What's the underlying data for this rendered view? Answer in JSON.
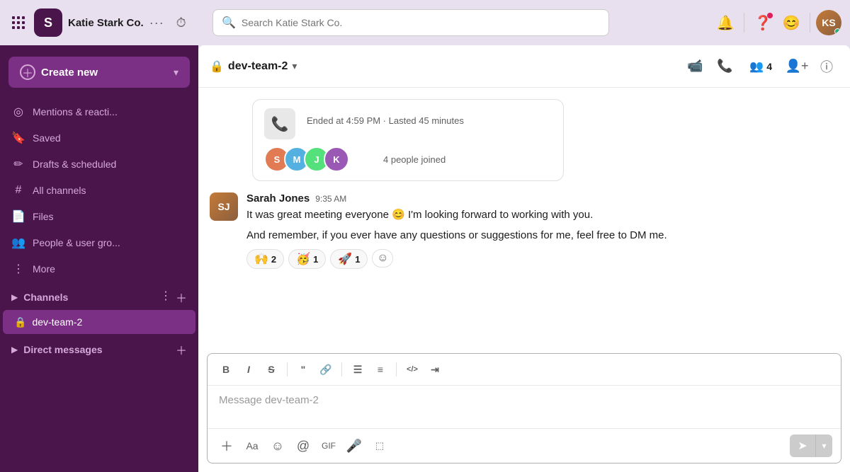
{
  "topbar": {
    "workspace_name": "Katie Stark Co.",
    "workspace_dots": "···",
    "search_placeholder": "Search Katie Stark Co.",
    "app_logo_letter": "S"
  },
  "sidebar": {
    "create_new_label": "Create new",
    "nav_items": [
      {
        "id": "mentions",
        "icon": "@",
        "label": "Mentions & reacti..."
      },
      {
        "id": "saved",
        "icon": "🔖",
        "label": "Saved"
      },
      {
        "id": "drafts",
        "icon": "✏️",
        "label": "Drafts & scheduled"
      },
      {
        "id": "all-channels",
        "icon": "#",
        "label": "All channels"
      },
      {
        "id": "files",
        "icon": "📄",
        "label": "Files"
      },
      {
        "id": "people",
        "icon": "👥",
        "label": "People & user gro..."
      }
    ],
    "more_label": "More",
    "channels_label": "Channels",
    "channel_items": [
      {
        "id": "dev-team-2",
        "name": "dev-team-2",
        "active": true,
        "lock": true
      }
    ],
    "direct_messages_label": "Direct messages"
  },
  "chat": {
    "channel_name": "dev-team-2",
    "members_count": "4",
    "call_card": {
      "ended_text": "Ended at 4:59 PM · Lasted 45 minutes",
      "joined_text": "4 people joined"
    },
    "message": {
      "author": "Sarah Jones",
      "time": "9:35 AM",
      "text1": "It was great meeting everyone 😊 I'm looking forward to working with you.",
      "text2": "And remember, if you ever have any questions or suggestions for me, feel free to DM me.",
      "reactions": [
        {
          "emoji": "🙌",
          "count": "2"
        },
        {
          "emoji": "🥳",
          "count": "1"
        },
        {
          "emoji": "🚀",
          "count": "1"
        }
      ]
    },
    "compose_placeholder": "Message dev-team-2"
  },
  "toolbar": {
    "bold": "B",
    "italic": "I",
    "strikethrough": "S",
    "quote": "❝",
    "link": "🔗",
    "bullet": "≡",
    "number": "≣",
    "code": "</>",
    "indent": "⇥"
  }
}
